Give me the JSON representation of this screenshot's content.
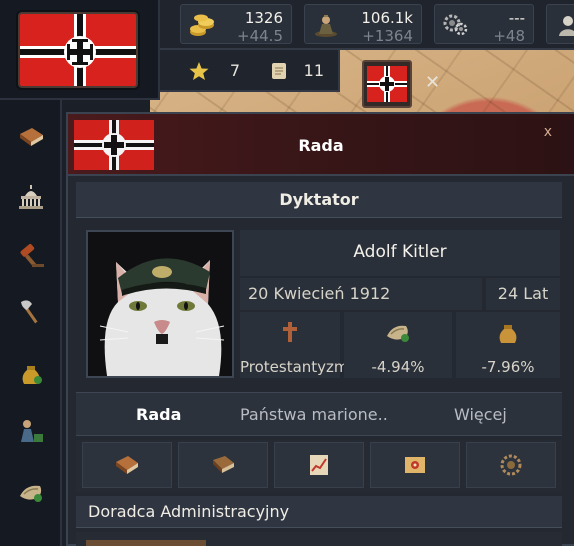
{
  "colors": {
    "flag_red": "#d8221e",
    "panel_bg": "#232831",
    "header_red": "#4a1a1c",
    "text": "#f3f1ea",
    "muted": "#7d8490"
  },
  "resources": [
    {
      "icon": "gold-coins-icon",
      "value": "1326",
      "delta": "+44.5"
    },
    {
      "icon": "manpower-icon",
      "value": "106.1k",
      "delta": "+1364"
    },
    {
      "icon": "gears-icon",
      "value": "---",
      "delta": "+48"
    }
  ],
  "sub_resources": [
    {
      "icon": "star-icon",
      "value": "7"
    },
    {
      "icon": "scroll-icon",
      "value": "11"
    }
  ],
  "map_close": "✕",
  "sidebar": [
    {
      "icon": "book-icon"
    },
    {
      "icon": "capitol-icon"
    },
    {
      "icon": "gavel-icon"
    },
    {
      "icon": "axe-icon"
    },
    {
      "icon": "money-bag-icon"
    },
    {
      "icon": "military-icon"
    },
    {
      "icon": "trade-icon"
    }
  ],
  "panel": {
    "title": "Rada",
    "close": "x",
    "section": "Dyktator",
    "ruler": {
      "name": "Adolf Kitler",
      "birth_date": "20 Kwiecień 1912",
      "age": "24 Lat",
      "stats": [
        {
          "icon": "cross-icon",
          "value": "Protestantyzm"
        },
        {
          "icon": "trade-icon",
          "value": "-4.94%"
        },
        {
          "icon": "money-bag-icon",
          "value": "-7.96%"
        }
      ]
    },
    "tabs": [
      "Rada",
      "Państwa marione..",
      "Więcej"
    ],
    "tab_icons": [
      "book-icon",
      "ledger-icon",
      "chart-icon",
      "map-icon",
      "gear-icon"
    ],
    "advisor_label": "Doradca Administracyjny"
  }
}
